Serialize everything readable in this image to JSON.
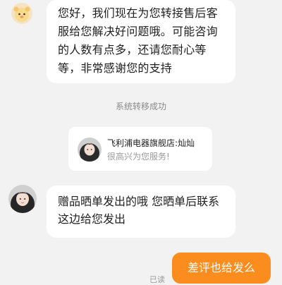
{
  "colors": {
    "background": "#f2f2f2",
    "incoming_bubble": "#ffffff",
    "outgoing_bubble": "#fb8c1e",
    "system_text": "#8a8a8a"
  },
  "messages": [
    {
      "id": "bot-greeting",
      "sender": "bot",
      "avatar_icon": "cartoon-bot-avatar-icon",
      "text": "您好，我们现在为您转接售后客服给您解决好问题哦。可能咨询的人数有点多，还请您耐心等等，非常感谢您的支持"
    },
    {
      "id": "system-transfer",
      "type": "system",
      "text": "系统转移成功"
    },
    {
      "id": "agent-card",
      "type": "agent-card",
      "avatar_icon": "agent-avatar-icon",
      "title": "飞利浦电器旗舰店:灿灿",
      "subtitle": "很高兴为您服务!"
    },
    {
      "id": "agent-message",
      "sender": "agent",
      "avatar_icon": "agent-avatar-icon",
      "text": "赠品晒单发出的哦 您晒单后联系这边给您发出"
    },
    {
      "id": "user-message",
      "sender": "user",
      "text": "差评也给发么",
      "status": "已读"
    }
  ]
}
